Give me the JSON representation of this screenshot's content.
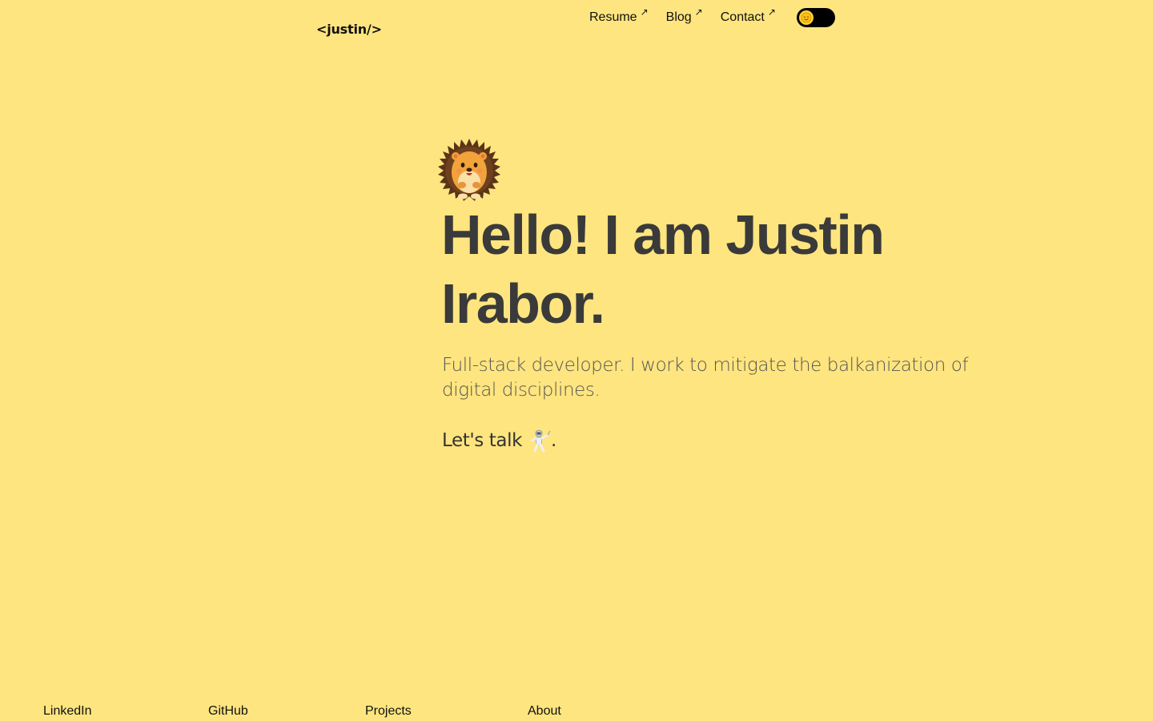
{
  "header": {
    "logo": "<justin/>",
    "nav": [
      {
        "label": "Resume",
        "arrow": "↗"
      },
      {
        "label": "Blog",
        "arrow": "↗"
      },
      {
        "label": "Contact",
        "arrow": "↗"
      }
    ],
    "theme_toggle": {
      "icon": "sun-icon",
      "state": "off"
    }
  },
  "hero": {
    "avatar_icon": "hedgehog-icon",
    "title": "Hello! I am Justin Irabor.",
    "subtitle": "Full-stack developer. I work to mitigate the balkanization of digital disciplines.",
    "cta_text": "Let's talk",
    "cta_icon": "person-fencing-icon",
    "cta_suffix": "."
  },
  "footer": {
    "links": [
      "LinkedIn",
      "GitHub",
      "Projects",
      "About"
    ]
  },
  "colors": {
    "background": "#ffe57f",
    "heading": "#3a3a3a",
    "toggle": "#000000",
    "toggle_knob": "#ffd43b"
  }
}
